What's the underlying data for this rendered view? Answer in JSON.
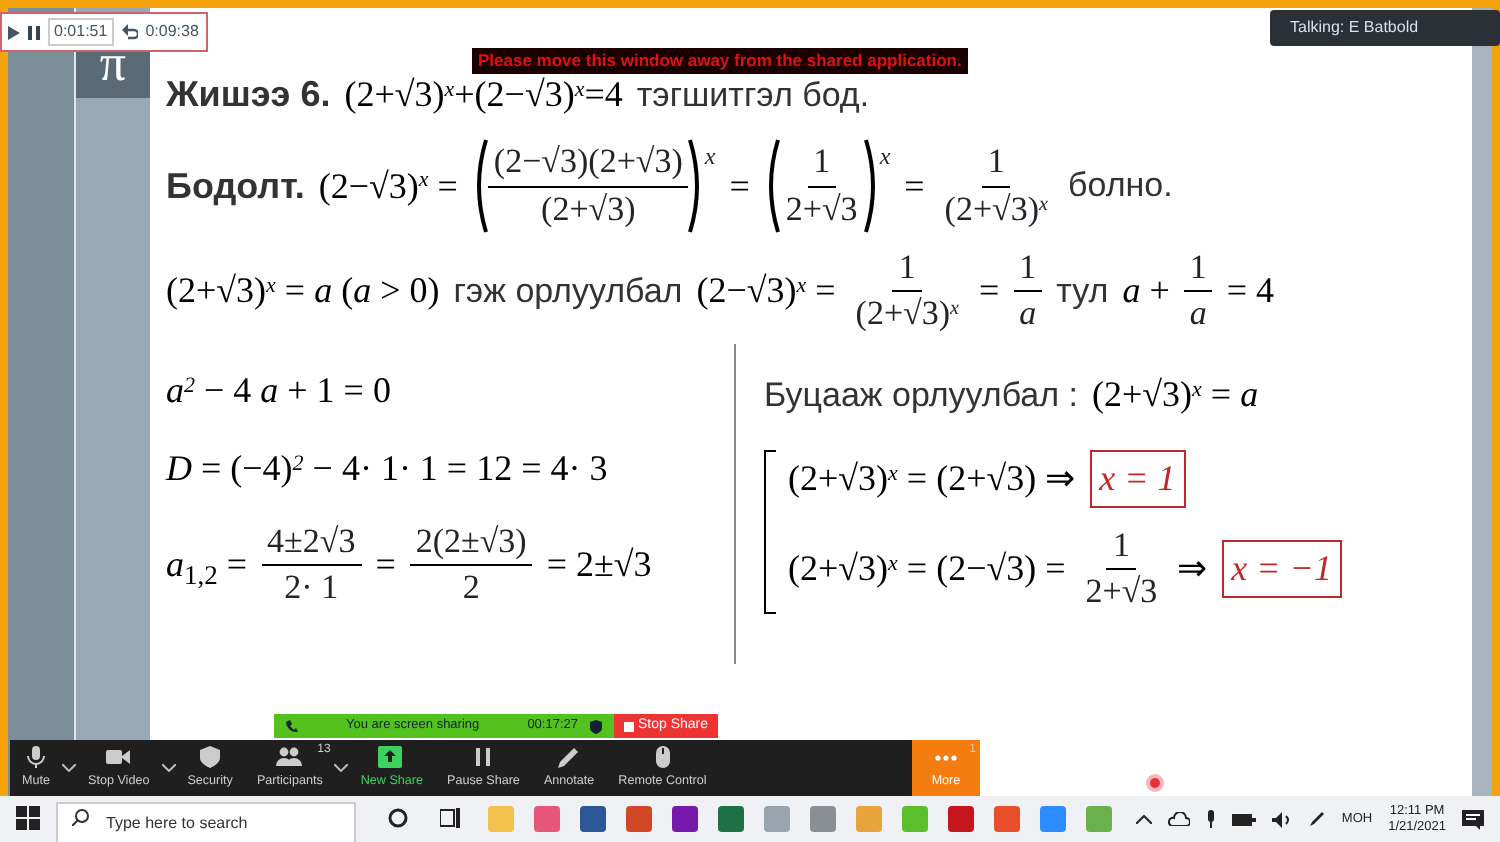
{
  "recording": {
    "elapsed": "0:01:51",
    "total": "0:09:38"
  },
  "warning_banner": "Please move this window away from the shared application.",
  "talking_tooltip": "Talking: E Batbold",
  "slide": {
    "sidebar_symbol": "π",
    "lines": [
      [
        {
          "kind": "title",
          "text": "Жишээ 6."
        },
        {
          "kind": "math",
          "text": "(2+√3)$^{x}$+(2−√3)$^{x}$=4"
        },
        {
          "kind": "word",
          "text": "тэгшитгэл бод."
        }
      ],
      [
        {
          "kind": "title",
          "text": "Бодолт."
        },
        {
          "kind": "math",
          "text": "(2−√3)$^{x}$ ="
        },
        {
          "kind": "frac",
          "parens": true,
          "sup": "x",
          "num": "(2−√3)(2+√3)",
          "den": "(2+√3)"
        },
        {
          "kind": "math",
          "text": "="
        },
        {
          "kind": "frac",
          "parens": true,
          "sup": "x",
          "num": "1",
          "den": "2+√3"
        },
        {
          "kind": "math",
          "text": "="
        },
        {
          "kind": "frac",
          "num": "1",
          "den": "(2+√3)$^{x}$"
        },
        {
          "kind": "word",
          "text": "болно."
        }
      ],
      [
        {
          "kind": "math",
          "text": "(2+√3)$^{x}$ = *a* (*a* > 0)"
        },
        {
          "kind": "word",
          "text": "гэж орлуулбал"
        },
        {
          "kind": "math",
          "text": "(2−√3)$^{x}$ ="
        },
        {
          "kind": "frac",
          "num": "1",
          "den": "(2+√3)$^{x}$"
        },
        {
          "kind": "math",
          "text": "="
        },
        {
          "kind": "frac",
          "num": "1",
          "den": "*a*"
        },
        {
          "kind": "word",
          "text": "тул"
        },
        {
          "kind": "math",
          "text": "*a* +"
        },
        {
          "kind": "frac",
          "num": "1",
          "den": "*a*"
        },
        {
          "kind": "math",
          "text": "= 4"
        }
      ]
    ],
    "left_column": [
      [
        {
          "kind": "math",
          "text": "*a*$^{2}$ − 4 *a* + 1 = 0"
        }
      ],
      [
        {
          "kind": "math",
          "text": "*D* = (−4)$^{2}$ − 4· 1· 1 = 12 = 4· 3"
        }
      ],
      [
        {
          "kind": "math",
          "text": "*a*$_{1,2}$ ="
        },
        {
          "kind": "frac",
          "num": "4±2√3",
          "den": "2· 1"
        },
        {
          "kind": "math",
          "text": "="
        },
        {
          "kind": "frac",
          "num": "2(2±√3)",
          "den": "2"
        },
        {
          "kind": "math",
          "text": "= 2±√3"
        }
      ]
    ],
    "right_heading": [
      {
        "kind": "word",
        "text": "Буцааж орлуулбал :"
      },
      {
        "kind": "math",
        "text": "(2+√3)$^{x}$ = *a*"
      }
    ],
    "system": [
      [
        {
          "kind": "math",
          "text": "(2+√3)$^{x}$ = (2+√3) ⇒"
        },
        {
          "kind": "boxed",
          "text": "x = 1"
        }
      ],
      [
        {
          "kind": "math",
          "text": "(2+√3)$^{x}$ = (2−√3) ="
        },
        {
          "kind": "frac",
          "num": "1",
          "den": "2+√3"
        },
        {
          "kind": "math",
          "text": "⇒"
        },
        {
          "kind": "boxed",
          "text": "x = −1"
        }
      ]
    ]
  },
  "sharing_bar": {
    "label": "You are screen sharing",
    "timer": "00:17:27",
    "stop_button": "Stop Share"
  },
  "toolbar": [
    {
      "label": "Mute",
      "kind": "mic",
      "caret": true
    },
    {
      "label": "Stop Video",
      "kind": "camera",
      "caret": true
    },
    {
      "label": "Security",
      "kind": "shield",
      "caret": false
    },
    {
      "label": "Participants",
      "kind": "people",
      "badge": "13",
      "caret": true
    },
    {
      "label": "New Share",
      "kind": "share",
      "caret": false
    },
    {
      "label": "Pause Share",
      "kind": "pause",
      "caret": false
    },
    {
      "label": "Annotate",
      "kind": "pen",
      "caret": false
    },
    {
      "label": "Remote Control",
      "kind": "mouse",
      "caret": false
    },
    {
      "label": "More",
      "kind": "dots",
      "badge": "1",
      "caret": false
    }
  ],
  "taskbar": {
    "search_placeholder": "Type here to search",
    "apps": [
      {
        "color": "#f2c14e"
      },
      {
        "color": "#e8567c"
      },
      {
        "color": "#2b5797"
      },
      {
        "color": "#d24726"
      },
      {
        "color": "#7719aa"
      },
      {
        "color": "#1e7145"
      },
      {
        "color": "#9aa4ad"
      },
      {
        "color": "#8a8f94"
      },
      {
        "color": "#e8a33c"
      },
      {
        "color": "#5bbf2b"
      },
      {
        "color": "#c4161c"
      },
      {
        "color": "#e94e2a"
      },
      {
        "color": "#2d8cff"
      },
      {
        "color": "#6ab04c"
      }
    ],
    "language": "MOH",
    "time": "12:11 PM",
    "date": "1/21/2021"
  }
}
